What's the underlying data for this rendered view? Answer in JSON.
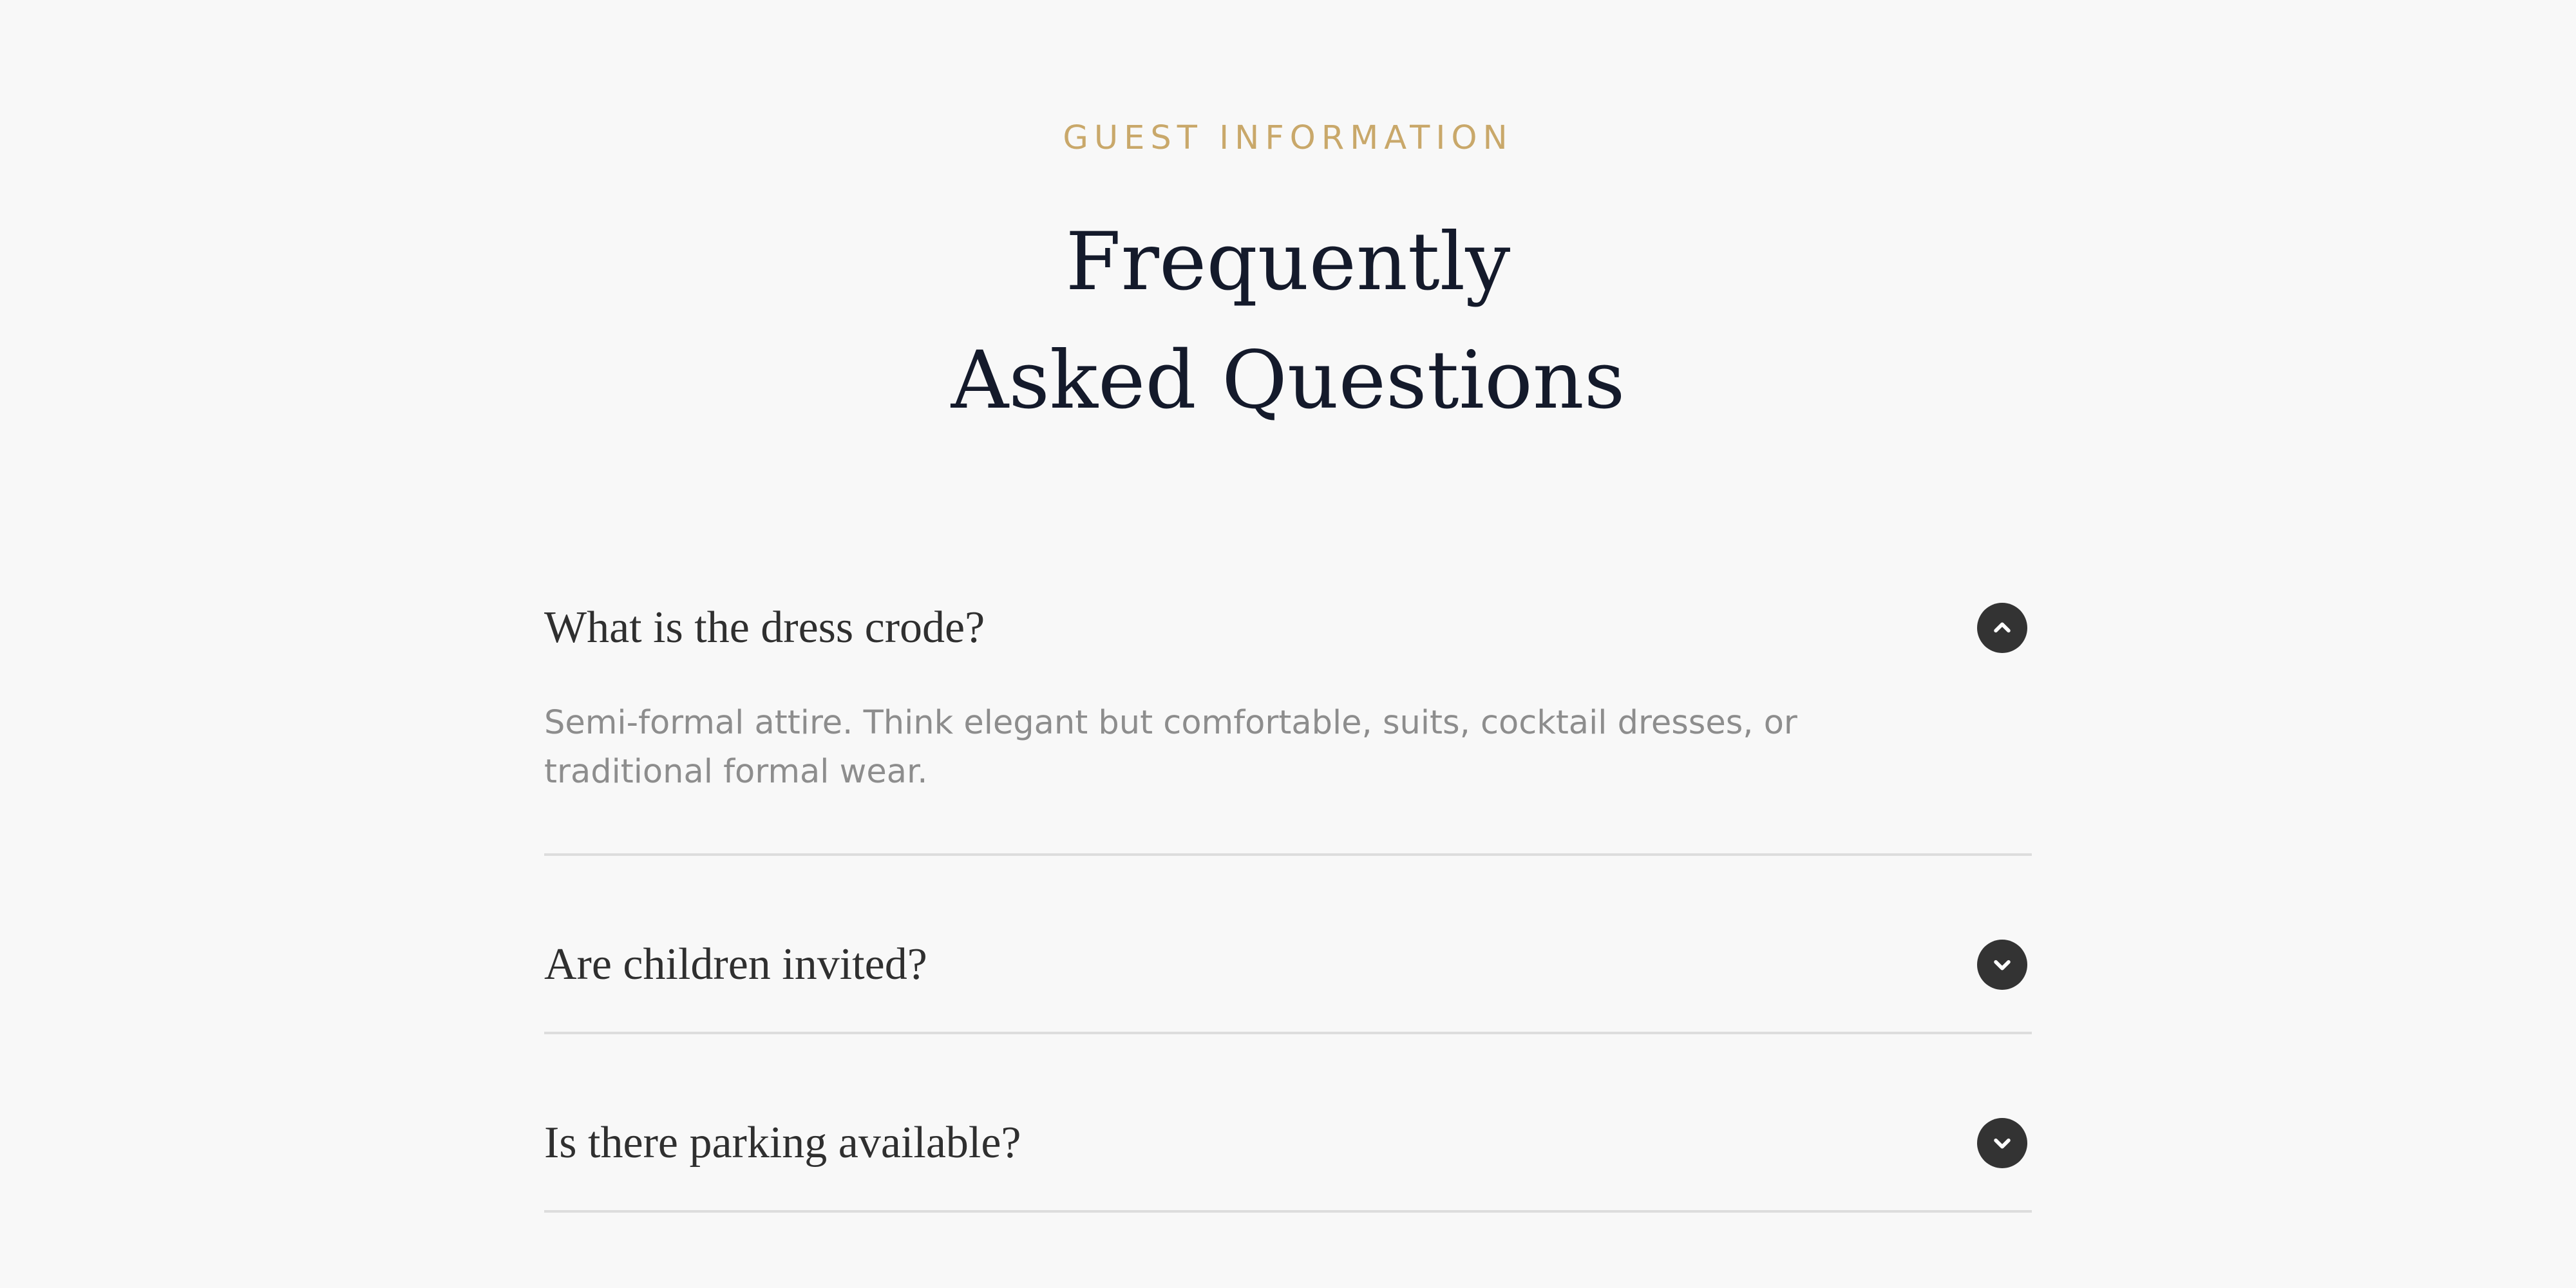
{
  "header": {
    "eyebrow": "GUEST INFORMATION",
    "title_line1": "Frequently",
    "title_line2": "Asked Questions"
  },
  "faq": [
    {
      "question": "What is the dress crode?",
      "expanded": true,
      "toggle_icon": "chevron-up-icon",
      "answer": "Semi-formal attire. Think elegant but comfortable, suits, cocktail dresses, or traditional formal wear."
    },
    {
      "question": "Are children invited?",
      "expanded": false,
      "toggle_icon": "chevron-down-icon"
    },
    {
      "question": "Is there parking available?",
      "expanded": false,
      "toggle_icon": "chevron-down-icon"
    }
  ],
  "colors": {
    "background": "#f8f8f8",
    "eyebrow": "#c9a86a",
    "title": "#141a2b",
    "question": "#2f2f2f",
    "answer": "#8d8d8d",
    "toggle": "#333333",
    "divider": "#dddddd"
  }
}
